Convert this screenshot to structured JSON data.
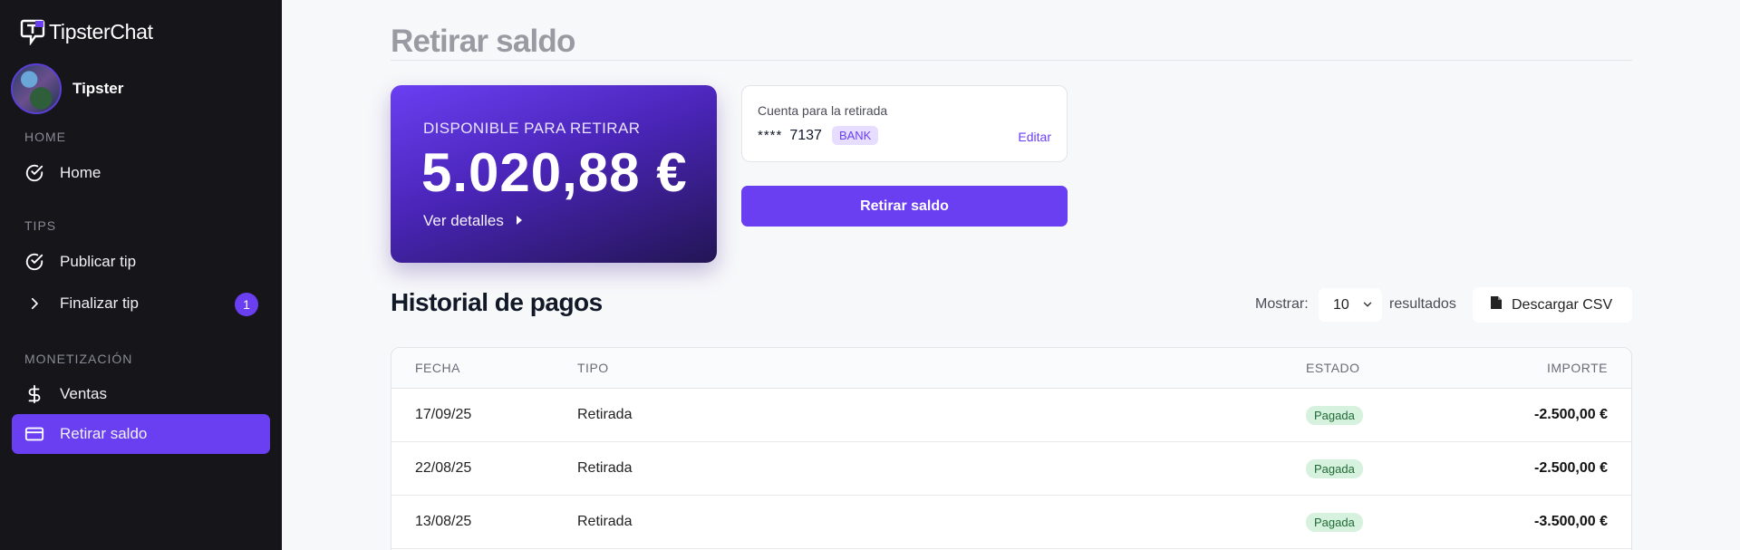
{
  "app": {
    "name": "TipsterChat"
  },
  "user": {
    "name": "Tipster"
  },
  "sidebar": {
    "sections": [
      {
        "label": "HOME"
      },
      {
        "label": "TIPS"
      },
      {
        "label": "MONETIZACIÓN"
      }
    ],
    "items": [
      {
        "label": "Home",
        "icon": "check-circle-icon"
      },
      {
        "label": "Publicar tip",
        "icon": "check-circle-icon"
      },
      {
        "label": "Finalizar tip",
        "icon": "chevron-right-icon",
        "badge": "1"
      },
      {
        "label": "Ventas",
        "icon": "dollar-icon"
      },
      {
        "label": "Retirar saldo",
        "icon": "credit-card-icon",
        "active": true
      }
    ]
  },
  "page": {
    "title": "Retirar saldo"
  },
  "balance": {
    "label": "DISPONIBLE PARA RETIRAR",
    "amount": "5.020,88 €",
    "details_label": "Ver detalles"
  },
  "account": {
    "label": "Cuenta para la retirada",
    "masked": "****",
    "last_digits": "7137",
    "type": "BANK",
    "edit_label": "Editar"
  },
  "withdraw_button": {
    "label": "Retirar saldo"
  },
  "history": {
    "title": "Historial de pagos",
    "show_label": "Mostrar:",
    "page_size": "10",
    "results_label": "resultados",
    "csv_label": "Descargar CSV",
    "columns": [
      "FECHA",
      "TIPO",
      "ESTADO",
      "IMPORTE"
    ],
    "rows": [
      {
        "date": "17/09/25",
        "type": "Retirada",
        "status": "Pagada",
        "amount": "-2.500,00 €"
      },
      {
        "date": "22/08/25",
        "type": "Retirada",
        "status": "Pagada",
        "amount": "-2.500,00 €"
      },
      {
        "date": "13/08/25",
        "type": "Retirada",
        "status": "Pagada",
        "amount": "-3.500,00 €"
      }
    ]
  },
  "colors": {
    "accent": "#6a3ff2",
    "sidebar_bg": "#15151a",
    "status_paid_bg": "#d6f1dd"
  }
}
